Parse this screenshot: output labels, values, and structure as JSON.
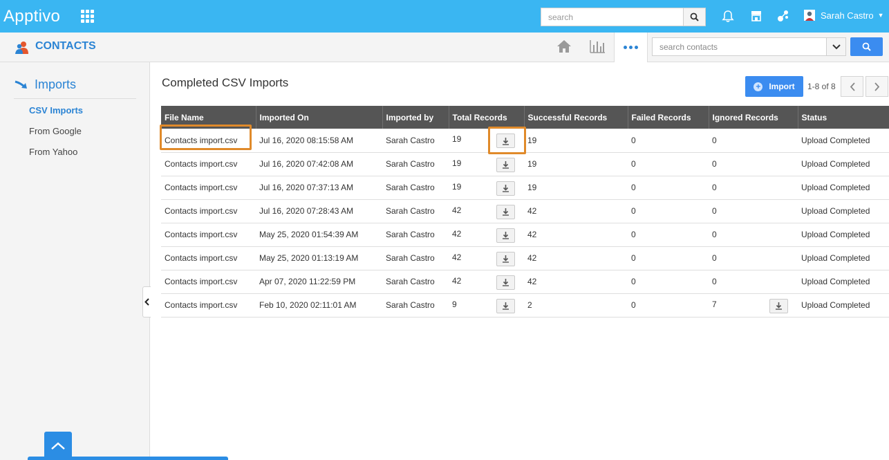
{
  "header": {
    "logo_text": "Apptivo",
    "search_placeholder": "search",
    "user_name": "Sarah Castro"
  },
  "app": {
    "title": "CONTACTS",
    "search_placeholder": "search contacts"
  },
  "sidebar": {
    "heading": "Imports",
    "items": [
      {
        "label": "CSV Imports",
        "active": true
      },
      {
        "label": "From Google"
      },
      {
        "label": "From Yahoo"
      }
    ]
  },
  "main": {
    "title": "Completed CSV Imports",
    "import_label": "Import",
    "pager": "1-8 of 8",
    "columns": [
      "File Name",
      "Imported On",
      "Imported by",
      "Total Records",
      "Successful Records",
      "Failed Records",
      "Ignored Records",
      "Status"
    ],
    "rows": [
      {
        "file": "Contacts import.csv",
        "date": "Jul 16, 2020 08:15:58 AM",
        "by": "Sarah Castro",
        "total": "19",
        "success": "19",
        "failed": "0",
        "ignored": "0",
        "status": "Upload Completed"
      },
      {
        "file": "Contacts import.csv",
        "date": "Jul 16, 2020 07:42:08 AM",
        "by": "Sarah Castro",
        "total": "19",
        "success": "19",
        "failed": "0",
        "ignored": "0",
        "status": "Upload Completed"
      },
      {
        "file": "Contacts import.csv",
        "date": "Jul 16, 2020 07:37:13 AM",
        "by": "Sarah Castro",
        "total": "19",
        "success": "19",
        "failed": "0",
        "ignored": "0",
        "status": "Upload Completed"
      },
      {
        "file": "Contacts import.csv",
        "date": "Jul 16, 2020 07:28:43 AM",
        "by": "Sarah Castro",
        "total": "42",
        "success": "42",
        "failed": "0",
        "ignored": "0",
        "status": "Upload Completed"
      },
      {
        "file": "Contacts import.csv",
        "date": "May 25, 2020 01:54:39 AM",
        "by": "Sarah Castro",
        "total": "42",
        "success": "42",
        "failed": "0",
        "ignored": "0",
        "status": "Upload Completed"
      },
      {
        "file": "Contacts import.csv",
        "date": "May 25, 2020 01:13:19 AM",
        "by": "Sarah Castro",
        "total": "42",
        "success": "42",
        "failed": "0",
        "ignored": "0",
        "status": "Upload Completed"
      },
      {
        "file": "Contacts import.csv",
        "date": "Apr 07, 2020 11:22:59 PM",
        "by": "Sarah Castro",
        "total": "42",
        "success": "42",
        "failed": "0",
        "ignored": "0",
        "status": "Upload Completed"
      },
      {
        "file": "Contacts import.csv",
        "date": "Feb 10, 2020 02:11:01 AM",
        "by": "Sarah Castro",
        "total": "9",
        "success": "2",
        "failed": "0",
        "ignored": "7",
        "ignored_download": true,
        "status": "Upload Completed"
      }
    ]
  },
  "colors": {
    "topbar": "#3ab6f2",
    "accent": "#2b84d4",
    "button": "#3b8cf0",
    "table_header": "#555555",
    "highlight": "#e08a2a"
  }
}
